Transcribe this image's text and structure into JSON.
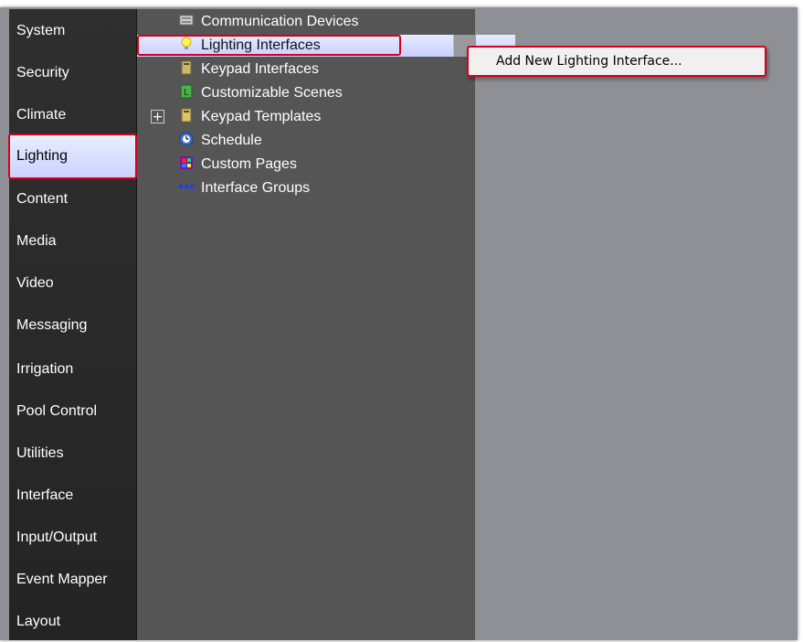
{
  "sidebar": {
    "items": [
      {
        "label": "System"
      },
      {
        "label": "Security"
      },
      {
        "label": "Climate"
      },
      {
        "label": "Lighting"
      },
      {
        "label": "Content"
      },
      {
        "label": "Media"
      },
      {
        "label": "Video"
      },
      {
        "label": "Messaging"
      },
      {
        "label": "Irrigation"
      },
      {
        "label": "Pool Control"
      },
      {
        "label": "Utilities"
      },
      {
        "label": "Interface"
      },
      {
        "label": "Input/Output"
      },
      {
        "label": "Event Mapper"
      },
      {
        "label": "Layout"
      }
    ],
    "selected": "Lighting"
  },
  "tree": {
    "nodes": [
      {
        "label": "Communication Devices",
        "icon": "network-devices-icon"
      },
      {
        "label": "Lighting Interfaces",
        "icon": "light-bulb-icon"
      },
      {
        "label": "Keypad Interfaces",
        "icon": "keypad-icon"
      },
      {
        "label": "Customizable Scenes",
        "icon": "scene-icon"
      },
      {
        "label": "Keypad Templates",
        "icon": "keypad-template-icon"
      },
      {
        "label": "Schedule",
        "icon": "clock-globe-icon"
      },
      {
        "label": "Custom Pages",
        "icon": "custom-pages-icon"
      },
      {
        "label": "Interface Groups",
        "icon": "interface-groups-icon"
      }
    ],
    "expander_symbol": "+"
  },
  "context_menu": {
    "items": [
      {
        "label": "Add New Lighting Interface..."
      }
    ]
  },
  "colors": {
    "highlight_outline": "#d7001b",
    "selection_fill": "#dde3ff",
    "sidebar_bg": "#2a2a2a",
    "tree_bg": "#555555",
    "workspace_bg": "#8f9096"
  }
}
